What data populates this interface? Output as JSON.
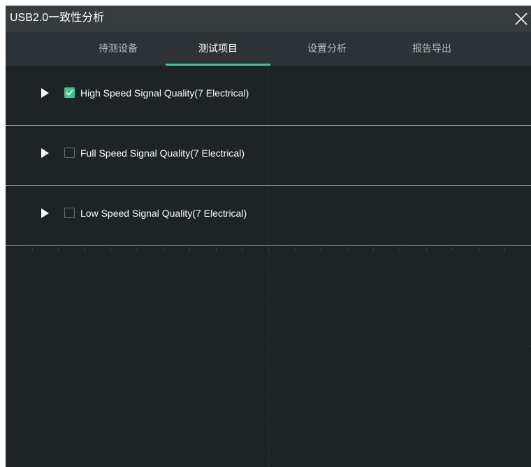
{
  "window": {
    "title": "USB2.0一致性分析"
  },
  "tabs": [
    {
      "label": "待测设备",
      "active": false
    },
    {
      "label": "测试项目",
      "active": true
    },
    {
      "label": "设置分析",
      "active": false
    },
    {
      "label": "报告导出",
      "active": false
    }
  ],
  "test_items": [
    {
      "label": "High Speed Signal Quality(7 Electrical)",
      "checked": true
    },
    {
      "label": "Full Speed Signal Quality(7 Electrical)",
      "checked": false
    },
    {
      "label": "Low Speed Signal Quality(7 Electrical)",
      "checked": false
    }
  ],
  "colors": {
    "accent": "#38c98a",
    "background": "#1e2326",
    "titlebar": "#373c3f",
    "tabbar": "#2c3235"
  },
  "icons": {
    "close": "close-icon",
    "expand": "expand-arrow-icon",
    "check": "checkmark-icon"
  }
}
